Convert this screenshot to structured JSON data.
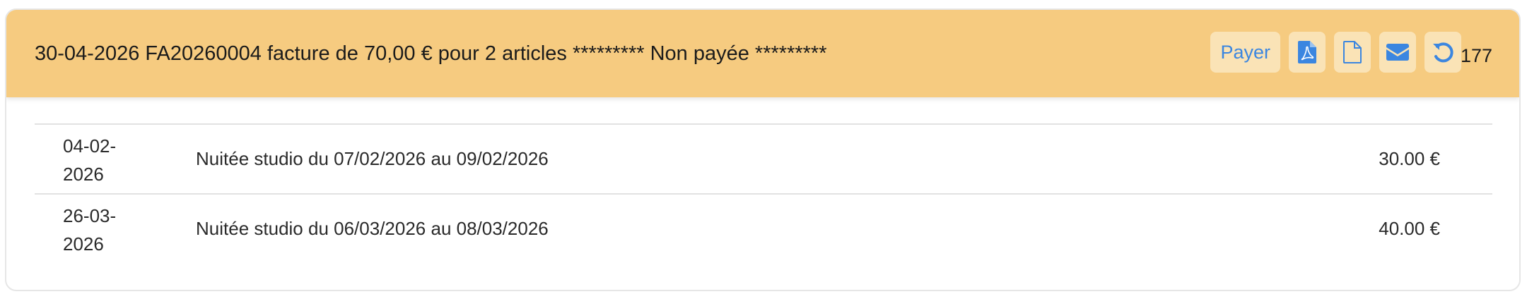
{
  "invoice": {
    "title": "30-04-2026 FA20260004 facture de 70,00 € pour 2 articles ********* Non payée *********",
    "pay_label": "Payer",
    "count": "177",
    "icons": [
      "pdf-icon",
      "document-icon",
      "envelope-icon",
      "refresh-icon"
    ],
    "colors": {
      "header_bg": "#f6cb80",
      "button_bg": "#fae3b6",
      "button_fg": "#3b86e0"
    }
  },
  "lines": [
    {
      "date": "04-02-\n2026",
      "description": "Nuitée studio du 07/02/2026 au 09/02/2026",
      "amount": "30.00 €"
    },
    {
      "date": "26-03-\n2026",
      "description": "Nuitée studio du 06/03/2026 au 08/03/2026",
      "amount": "40.00 €"
    }
  ]
}
